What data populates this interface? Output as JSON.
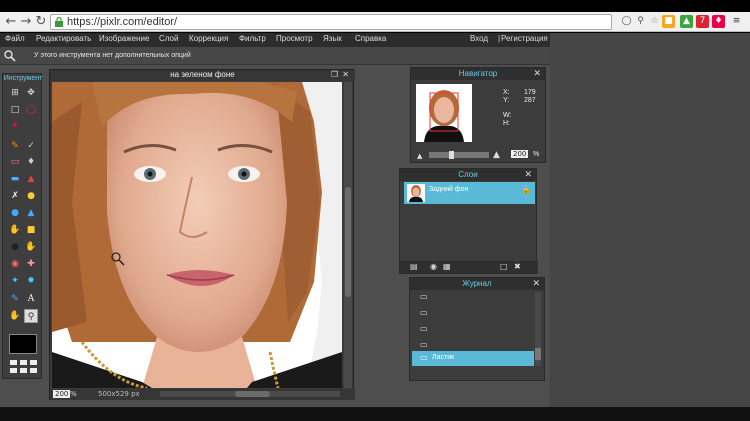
{
  "browser": {
    "url": "https://pixlr.com/editor/"
  },
  "menu": {
    "items": [
      "Файл",
      "Редактировать",
      "Изображение",
      "Слой",
      "Коррекция",
      "Фильтр",
      "Просмотр",
      "Язык",
      "Справка"
    ],
    "login": "Вход",
    "register": "Регистрация"
  },
  "options_bar": {
    "message": "У этого инструмента нет дополнительных опций"
  },
  "tools": {
    "title": "Инструмент"
  },
  "canvas": {
    "title": "на зеленом фоне",
    "zoom": "200",
    "zoom_unit": "%",
    "size": "500x529 px"
  },
  "navigator": {
    "title": "Навигатор",
    "x_label": "X:",
    "x_value": "179",
    "y_label": "Y:",
    "y_value": "287",
    "w_label": "W:",
    "h_label": "H:",
    "zoom": "200",
    "zoom_unit": "%"
  },
  "layers": {
    "title": "Слои",
    "items": [
      {
        "name": "Задний фон"
      }
    ]
  },
  "history": {
    "title": "Журнал",
    "items": [
      "",
      "",
      "",
      "",
      "Ластик"
    ],
    "selected": "Ластик"
  },
  "colors": {
    "accent": "#6cc8e6",
    "selected_row": "#5ab9d6",
    "app_bg": "#4e4e4e",
    "panel_bg": "#3c3c3c"
  }
}
